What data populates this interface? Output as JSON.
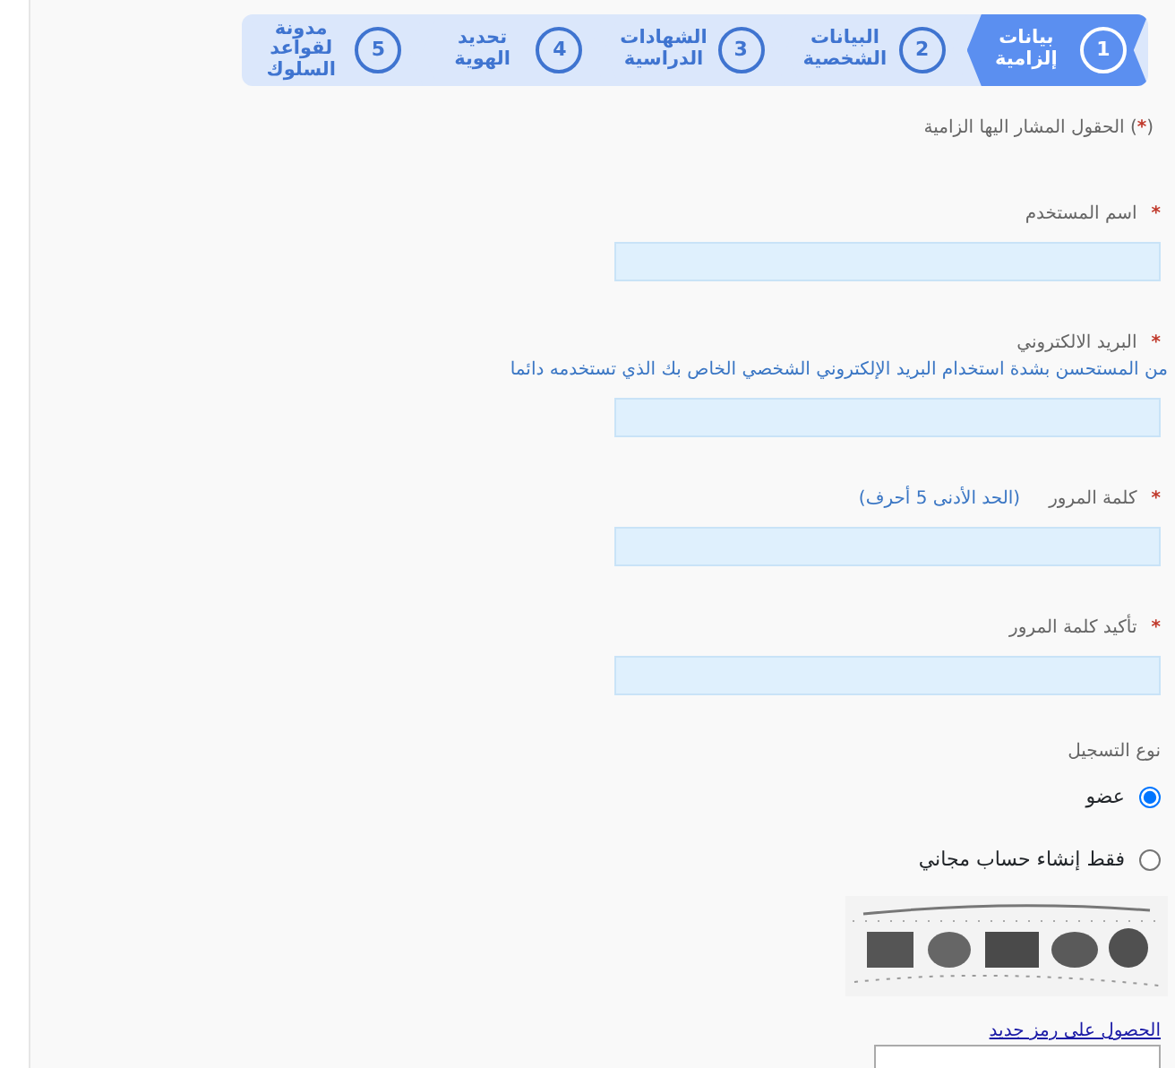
{
  "steps": [
    {
      "number": "1",
      "label": "بيانات إلزامية",
      "selected": true
    },
    {
      "number": "2",
      "label": "البيانات الشخصية",
      "selected": false
    },
    {
      "number": "3",
      "label": "الشهادات الدراسية",
      "selected": false
    },
    {
      "number": "4",
      "label": "تحديد الهوية",
      "selected": false
    },
    {
      "number": "5",
      "label": "مدونة لقواعد السلوك",
      "selected": false
    }
  ],
  "note": {
    "open": "(",
    "mark": "*",
    "close": ")",
    "text": "الحقول المشار اليها الزامية"
  },
  "fields": [
    {
      "mark": "*",
      "label": "اسم المستخدم",
      "kind": "plain"
    },
    {
      "mark": "*",
      "label": "البريد الالكتروني",
      "kind": "below",
      "hint": "من المستحسن بشدة استخدام البريد الإلكتروني الشخصي الخاص بك الذي تستخدمه دائما"
    },
    {
      "mark": "*",
      "label": "كلمة المرور",
      "kind": "inline",
      "hint": "(الحد الأدنى 5 أحرف)"
    },
    {
      "mark": "*",
      "label": "تأكيد كلمة المرور",
      "kind": "plain"
    }
  ],
  "registration": {
    "label": "نوع التسجيل",
    "options": [
      {
        "label": "عضو",
        "selected": true
      },
      {
        "label": "فقط إنشاء حساب مجاني",
        "selected": false
      }
    ]
  },
  "captcha": {
    "link": "الحصول على رمز جديد"
  }
}
